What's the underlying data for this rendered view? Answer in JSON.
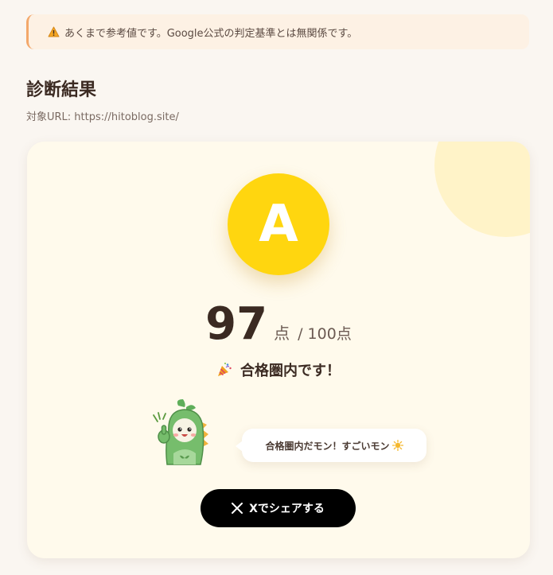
{
  "notice": {
    "icon": "warning-icon",
    "text": "あくまで参考値です。Google公式の判定基準とは無関係です。"
  },
  "header": {
    "title": "診断結果",
    "url_label": "対象URL: https://hitoblog.site/"
  },
  "result": {
    "grade": "A",
    "score": "97",
    "score_unit": "点",
    "score_total": "/ 100点",
    "message_icon": "party-popper-icon",
    "message": "合格圏内です！"
  },
  "mascot": {
    "icon": "dinosaur-mascot-icon",
    "speech": "合格圏内だモン！すごいモン",
    "speech_icon": "sun-icon"
  },
  "share": {
    "icon": "x-logo-icon",
    "label": "Xでシェアする"
  },
  "colors": {
    "accent_yellow": "#ffd60f",
    "warning_border": "#f3a86b",
    "card_bg": "#fffaec",
    "button_bg": "#000000"
  }
}
